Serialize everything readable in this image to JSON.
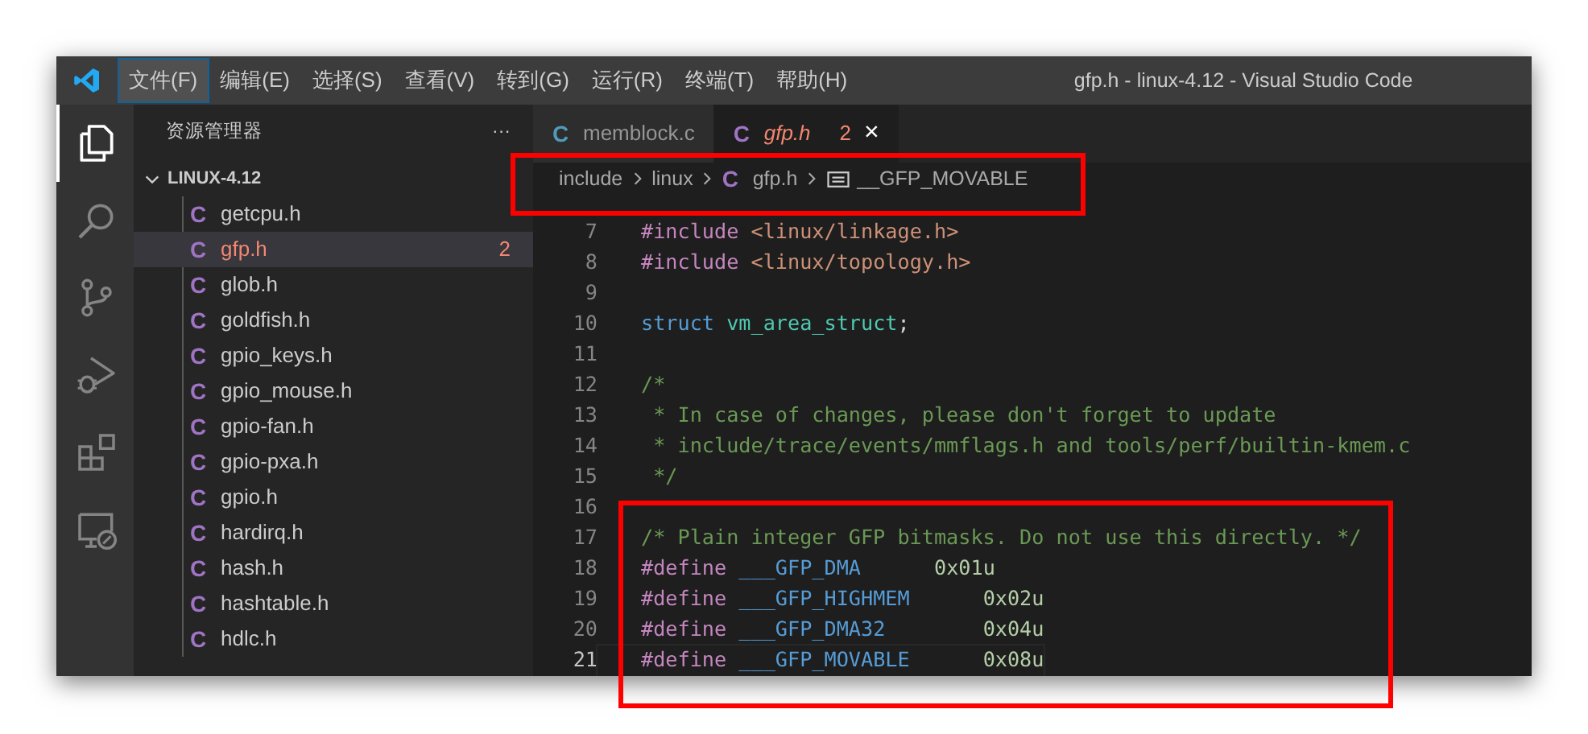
{
  "window": {
    "title": "gfp.h - linux-4.12 - Visual Studio Code"
  },
  "menu": [
    {
      "label": "文件(F)",
      "focused": true
    },
    {
      "label": "编辑(E)",
      "focused": false
    },
    {
      "label": "选择(S)",
      "focused": false
    },
    {
      "label": "查看(V)",
      "focused": false
    },
    {
      "label": "转到(G)",
      "focused": false
    },
    {
      "label": "运行(R)",
      "focused": false
    },
    {
      "label": "终端(T)",
      "focused": false
    },
    {
      "label": "帮助(H)",
      "focused": false
    }
  ],
  "activity_bar": [
    {
      "kind": "files",
      "selected": true
    },
    {
      "kind": "search",
      "selected": false
    },
    {
      "kind": "scm",
      "selected": false
    },
    {
      "kind": "debug",
      "selected": false
    },
    {
      "kind": "extensions",
      "selected": false
    },
    {
      "kind": "remote",
      "selected": false
    }
  ],
  "sidebar": {
    "title": "资源管理器",
    "more": "···",
    "section": "LINUX-4.12",
    "items": [
      {
        "icon": "C",
        "name": "getcpu.h",
        "selected": false,
        "error": false
      },
      {
        "icon": "C",
        "name": "gfp.h",
        "selected": true,
        "error": true,
        "badge": "2"
      },
      {
        "icon": "C",
        "name": "glob.h",
        "selected": false,
        "error": false
      },
      {
        "icon": "C",
        "name": "goldfish.h",
        "selected": false,
        "error": false
      },
      {
        "icon": "C",
        "name": "gpio_keys.h",
        "selected": false,
        "error": false
      },
      {
        "icon": "C",
        "name": "gpio_mouse.h",
        "selected": false,
        "error": false
      },
      {
        "icon": "C",
        "name": "gpio-fan.h",
        "selected": false,
        "error": false
      },
      {
        "icon": "C",
        "name": "gpio-pxa.h",
        "selected": false,
        "error": false
      },
      {
        "icon": "C",
        "name": "gpio.h",
        "selected": false,
        "error": false
      },
      {
        "icon": "C",
        "name": "hardirq.h",
        "selected": false,
        "error": false
      },
      {
        "icon": "C",
        "name": "hash.h",
        "selected": false,
        "error": false
      },
      {
        "icon": "C",
        "name": "hashtable.h",
        "selected": false,
        "error": false
      },
      {
        "icon": "C",
        "name": "hdlc.h",
        "selected": false,
        "error": false
      }
    ]
  },
  "tabs": [
    {
      "icon": "C",
      "color": "#519aba",
      "label": "memblock.c",
      "selected": false,
      "error": false
    },
    {
      "icon": "C",
      "color": "#a074c4",
      "label": "gfp.h",
      "selected": true,
      "error": true,
      "badge": "2",
      "close": "×"
    }
  ],
  "breadcrumbs": {
    "highlighted": true,
    "items": [
      {
        "kind": "folder",
        "label": "include"
      },
      {
        "kind": "folder",
        "label": "linux"
      },
      {
        "kind": "file",
        "icon": "C",
        "label": "gfp.h"
      },
      {
        "kind": "symbol",
        "label": "__GFP_MOVABLE"
      }
    ]
  },
  "code": {
    "lines": [
      {
        "number": "7",
        "current": false,
        "highlighted": false,
        "tokens": [
          {
            "text": "#include",
            "kind": "directive"
          },
          {
            "text": " <linux/linkage.h>",
            "kind": "string"
          }
        ]
      },
      {
        "number": "8",
        "current": false,
        "highlighted": false,
        "tokens": [
          {
            "text": "#include",
            "kind": "directive"
          },
          {
            "text": " <linux/topology.h>",
            "kind": "string"
          }
        ]
      },
      {
        "number": "9",
        "current": false,
        "highlighted": false
      },
      {
        "number": "10",
        "current": false,
        "highlighted": false,
        "tokens": [
          {
            "text": "struct",
            "kind": "keyword"
          },
          {
            "text": " vm_area_struct",
            "kind": "type"
          },
          {
            "text": ";",
            "kind": "plain"
          }
        ]
      },
      {
        "number": "11",
        "current": false,
        "highlighted": false
      },
      {
        "number": "12",
        "current": false,
        "highlighted": false,
        "tokens": [
          {
            "text": "/*",
            "kind": "comment"
          }
        ]
      },
      {
        "number": "13",
        "current": false,
        "highlighted": false,
        "tokens": [
          {
            "text": " * In case of changes, please don't forget to update",
            "kind": "comment"
          }
        ]
      },
      {
        "number": "14",
        "current": false,
        "highlighted": false,
        "tokens": [
          {
            "text": " * include/trace/events/mmflags.h and tools/perf/builtin-kmem.c",
            "kind": "comment"
          }
        ]
      },
      {
        "number": "15",
        "current": false,
        "highlighted": false,
        "tokens": [
          {
            "text": " */",
            "kind": "comment"
          }
        ]
      },
      {
        "number": "16",
        "current": false,
        "highlighted": false
      },
      {
        "number": "17",
        "current": false,
        "highlighted": true,
        "tokens": [
          {
            "text": "/* Plain integer GFP bitmasks. Do not use this directly. */",
            "kind": "comment"
          }
        ]
      },
      {
        "number": "18",
        "current": false,
        "highlighted": true,
        "tokens": [
          {
            "text": "#define",
            "kind": "directive"
          },
          {
            "text": " ___GFP_DMA      ",
            "kind": "macro"
          },
          {
            "text": "0x01u",
            "kind": "number"
          }
        ]
      },
      {
        "number": "19",
        "current": false,
        "highlighted": true,
        "tokens": [
          {
            "text": "#define",
            "kind": "directive"
          },
          {
            "text": " ___GFP_HIGHMEM      ",
            "kind": "macro"
          },
          {
            "text": "0x02u",
            "kind": "number"
          }
        ]
      },
      {
        "number": "20",
        "current": false,
        "highlighted": true,
        "tokens": [
          {
            "text": "#define",
            "kind": "directive"
          },
          {
            "text": " ___GFP_DMA32        ",
            "kind": "macro"
          },
          {
            "text": "0x04u",
            "kind": "number"
          }
        ]
      },
      {
        "number": "21",
        "current": true,
        "highlighted": true,
        "tokens": [
          {
            "text": "#define",
            "kind": "directive"
          },
          {
            "text": " ___GFP_MOVABLE      ",
            "kind": "macro"
          },
          {
            "text": "0x08u",
            "kind": "number"
          }
        ]
      }
    ]
  }
}
